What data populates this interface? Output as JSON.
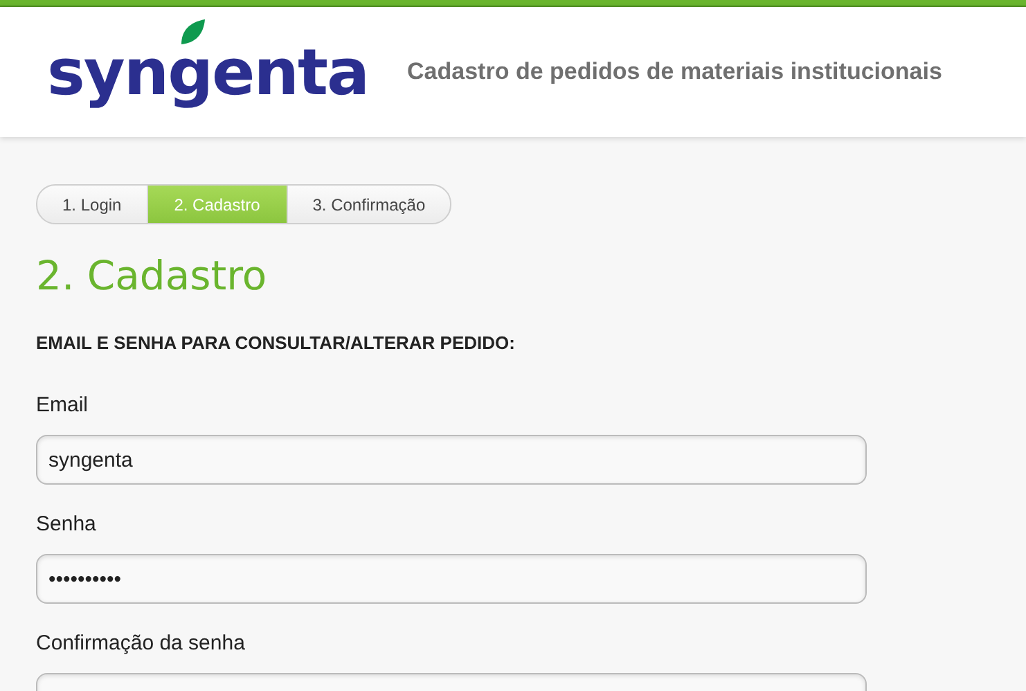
{
  "header": {
    "logo": "syngenta",
    "title": "Cadastro de pedidos de materiais institucionais"
  },
  "steps": [
    {
      "label": "1. Login",
      "selected": false
    },
    {
      "label": "2. Cadastro",
      "selected": true
    },
    {
      "label": "3. Confirmação",
      "selected": false
    }
  ],
  "heading": "2. Cadastro",
  "section_title": "EMAIL E SENHA PARA CONSULTAR/ALTERAR PEDIDO:",
  "fields": [
    {
      "label": "Email",
      "value": "syngenta"
    },
    {
      "label": "Senha",
      "value": "••••••••••"
    },
    {
      "label": "Confirmação da senha"
    }
  ]
}
